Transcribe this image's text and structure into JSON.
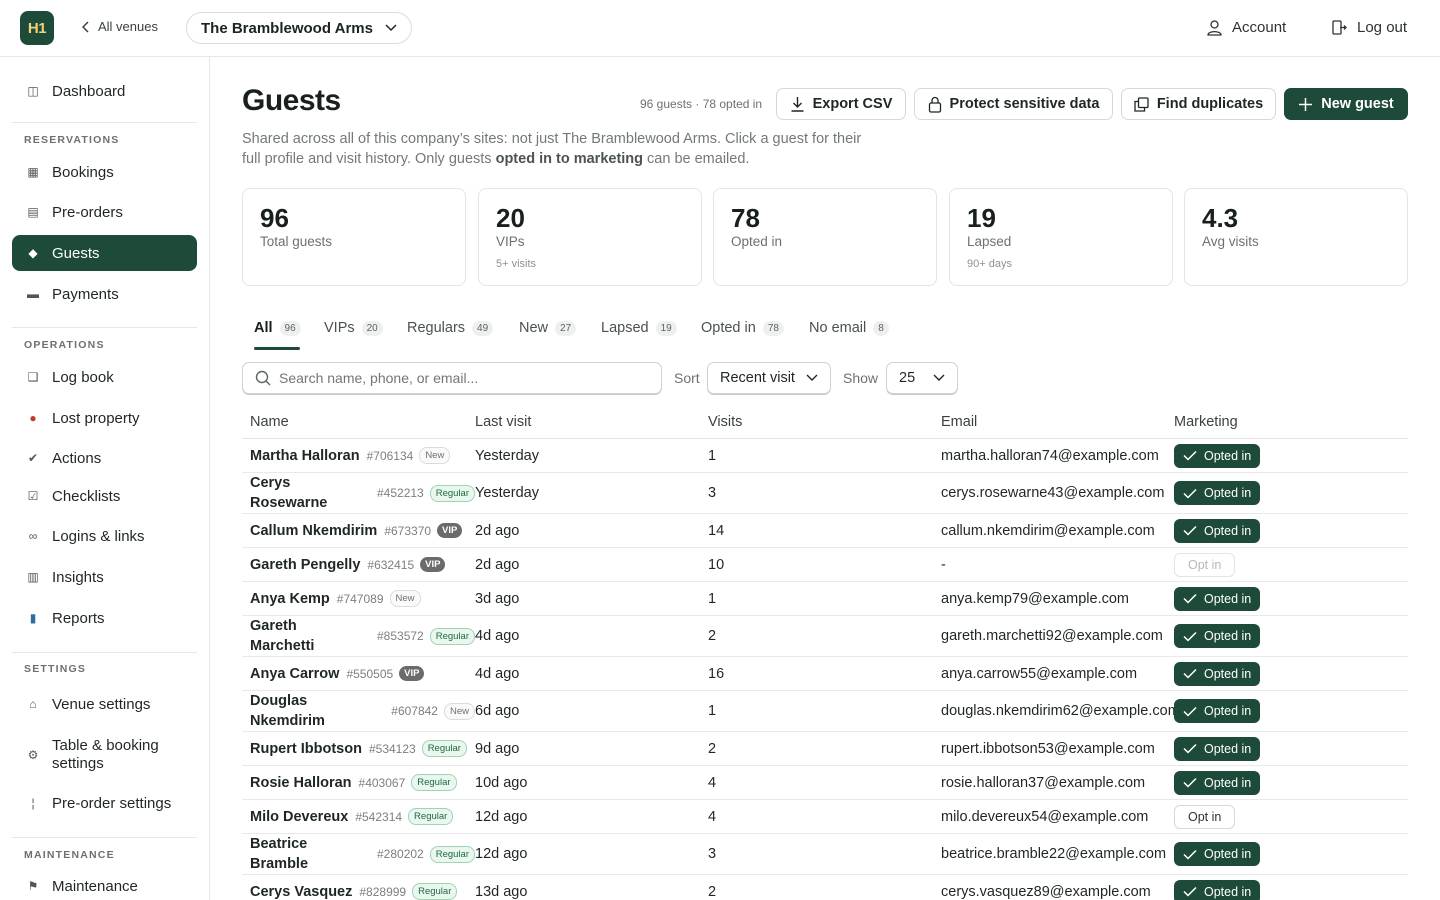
{
  "topbar": {
    "logo": "H1",
    "back_label": "All venues",
    "venue": "The Bramblewood Arms",
    "account": "Account",
    "logout": "Log out"
  },
  "sidebar": {
    "dashboard": "Dashboard",
    "sections": {
      "reservations": "RESERVATIONS",
      "operations": "OPERATIONS",
      "settings": "SETTINGS",
      "maintenance": "MAINTENANCE"
    },
    "items": {
      "bookings": "Bookings",
      "preorders": "Pre-orders",
      "guests": "Guests",
      "payments": "Payments",
      "logbook": "Log book",
      "lost": "Lost property",
      "actions": "Actions",
      "checklists": "Checklists",
      "logins": "Logins & links",
      "insights": "Insights",
      "reports": "Reports",
      "venue_settings": "Venue settings",
      "table_booking_1": "Table & booking",
      "table_booking_2": "settings",
      "preorder_settings": "Pre-order settings",
      "maintenance": "Maintenance"
    }
  },
  "header": {
    "title": "Guests",
    "count_text": "96 guests · 78 opted in",
    "export": "Export CSV",
    "protect": "Protect sensitive data",
    "duplicates": "Find duplicates",
    "new_guest": "New guest",
    "desc_1": "Shared across all of this company’s sites: not just The Bramblewood Arms. Click a guest for their full profile and visit history. Only guests ",
    "desc_bold": "opted in to marketing",
    "desc_2": " can be emailed."
  },
  "stats": [
    {
      "value": "96",
      "label": "Total guests",
      "sub": ""
    },
    {
      "value": "20",
      "label": "VIPs",
      "sub": "5+ visits"
    },
    {
      "value": "78",
      "label": "Opted in",
      "sub": ""
    },
    {
      "value": "19",
      "label": "Lapsed",
      "sub": "90+ days"
    },
    {
      "value": "4.3",
      "label": "Avg visits",
      "sub": ""
    }
  ],
  "tabs": [
    {
      "label": "All",
      "count": "96"
    },
    {
      "label": "VIPs",
      "count": "20"
    },
    {
      "label": "Regulars",
      "count": "49"
    },
    {
      "label": "New",
      "count": "27"
    },
    {
      "label": "Lapsed",
      "count": "19"
    },
    {
      "label": "Opted in",
      "count": "78"
    },
    {
      "label": "No email",
      "count": "8"
    }
  ],
  "filters": {
    "search_placeholder": "Search name, phone, or email...",
    "sort_label": "Sort",
    "sort_value": "Recent visit",
    "show_label": "Show",
    "show_value": "25"
  },
  "table": {
    "columns": [
      "Name",
      "Last visit",
      "Visits",
      "Email",
      "Marketing"
    ],
    "rows": [
      {
        "name": "Martha Halloran",
        "id": "#706134",
        "tag": "New",
        "last": "Yesterday",
        "visits": "1",
        "email": "martha.halloran74@example.com",
        "marketing": "Opted in"
      },
      {
        "name": "Cerys Rosewarne",
        "id": "#452213",
        "tag": "Regular",
        "last": "Yesterday",
        "visits": "3",
        "email": "cerys.rosewarne43@example.com",
        "marketing": "Opted in"
      },
      {
        "name": "Callum Nkemdirim",
        "id": "#673370",
        "tag": "VIP",
        "last": "2d ago",
        "visits": "14",
        "email": "callum.nkemdirim@example.com",
        "marketing": "Opted in"
      },
      {
        "name": "Gareth Pengelly",
        "id": "#632415",
        "tag": "VIP",
        "last": "2d ago",
        "visits": "10",
        "email": "-",
        "marketing": "Opt in"
      },
      {
        "name": "Anya Kemp",
        "id": "#747089",
        "tag": "New",
        "last": "3d ago",
        "visits": "1",
        "email": "anya.kemp79@example.com",
        "marketing": "Opted in"
      },
      {
        "name": "Gareth Marchetti",
        "id": "#853572",
        "tag": "Regular",
        "last": "4d ago",
        "visits": "2",
        "email": "gareth.marchetti92@example.com",
        "marketing": "Opted in"
      },
      {
        "name": "Anya Carrow",
        "id": "#550505",
        "tag": "VIP",
        "last": "4d ago",
        "visits": "16",
        "email": "anya.carrow55@example.com",
        "marketing": "Opted in"
      },
      {
        "name": "Douglas Nkemdirim",
        "id": "#607842",
        "tag": "New",
        "last": "6d ago",
        "visits": "1",
        "email": "douglas.nkemdirim62@example.com",
        "marketing": "Opted in"
      },
      {
        "name": "Rupert Ibbotson",
        "id": "#534123",
        "tag": "Regular",
        "last": "9d ago",
        "visits": "2",
        "email": "rupert.ibbotson53@example.com",
        "marketing": "Opted in"
      },
      {
        "name": "Rosie Halloran",
        "id": "#403067",
        "tag": "Regular",
        "last": "10d ago",
        "visits": "4",
        "email": "rosie.halloran37@example.com",
        "marketing": "Opted in"
      },
      {
        "name": "Milo Devereux",
        "id": "#542314",
        "tag": "Regular",
        "last": "12d ago",
        "visits": "4",
        "email": "milo.devereux54@example.com",
        "marketing": "Opt in"
      },
      {
        "name": "Beatrice Bramble",
        "id": "#280202",
        "tag": "Regular",
        "last": "12d ago",
        "visits": "3",
        "email": "beatrice.bramble22@example.com",
        "marketing": "Opted in"
      },
      {
        "name": "Cerys Vasquez",
        "id": "#828999",
        "tag": "Regular",
        "last": "13d ago",
        "visits": "2",
        "email": "cerys.vasquez89@example.com",
        "marketing": "Opted in"
      }
    ]
  },
  "colors": {
    "brand": "#1d4a39",
    "logo_text": "#f2d27a",
    "regular_tag": "#1d6a43"
  }
}
